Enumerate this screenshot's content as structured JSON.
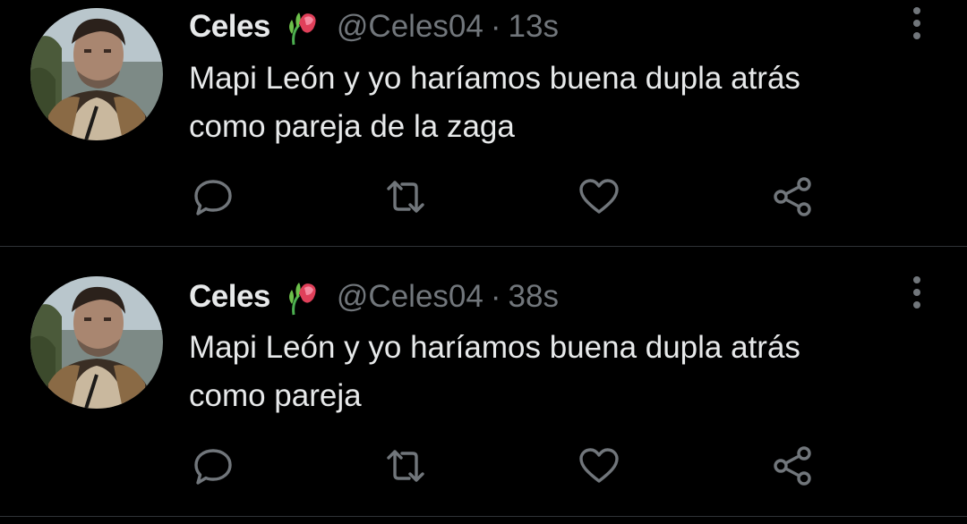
{
  "tweets": [
    {
      "display_name": "Celes",
      "handle": "@Celes04",
      "separator": "·",
      "time": "13s",
      "text_lines": [
        "Mapi León y yo haríamos buena dupla atrás",
        "como pareja de la zaga"
      ],
      "icons": {
        "reply": "reply-icon",
        "retweet": "retweet-icon",
        "like": "like-icon",
        "share": "share-icon",
        "more": "more-options-icon",
        "name_emoji": "wilted-flower-emoji"
      }
    },
    {
      "display_name": "Celes",
      "handle": "@Celes04",
      "separator": "·",
      "time": "38s",
      "text_lines": [
        "Mapi León y yo haríamos buena dupla atrás",
        "como pareja"
      ],
      "icons": {
        "reply": "reply-icon",
        "retweet": "retweet-icon",
        "like": "like-icon",
        "share": "share-icon",
        "more": "more-options-icon",
        "name_emoji": "wilted-flower-emoji"
      }
    }
  ],
  "colors": {
    "background": "#000000",
    "primary_text": "#e7e9ea",
    "secondary_text": "#71767b",
    "divider": "#2f3336"
  }
}
